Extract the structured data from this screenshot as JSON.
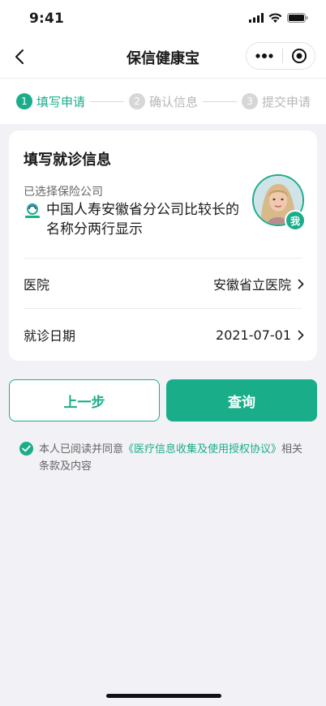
{
  "status_bar": {
    "time": "9:41"
  },
  "nav": {
    "title": "保信健康宝"
  },
  "steps": [
    {
      "num": "1",
      "label": "填写申请"
    },
    {
      "num": "2",
      "label": "确认信息"
    },
    {
      "num": "3",
      "label": "提交申请"
    }
  ],
  "active_step": 1,
  "card": {
    "title": "填写就诊信息",
    "company_caption": "已选择保险公司",
    "company_logo_text": "中国人寿",
    "company_name": "中国人寿安徽省分公司比较长的名称分两行显示",
    "avatar_badge": "我",
    "rows": [
      {
        "label": "医院",
        "value": "安徽省立医院"
      },
      {
        "label": "就诊日期",
        "value": "2021-07-01"
      }
    ]
  },
  "buttons": {
    "prev": "上一步",
    "query": "查询"
  },
  "agreement": {
    "prefix": "本人已阅读并同意",
    "link": "《医疗信息收集及使用授权协议》",
    "suffix": "相关条款及内容",
    "checked": true
  },
  "colors": {
    "accent": "#1aad8a",
    "background": "#f2f2f6"
  }
}
